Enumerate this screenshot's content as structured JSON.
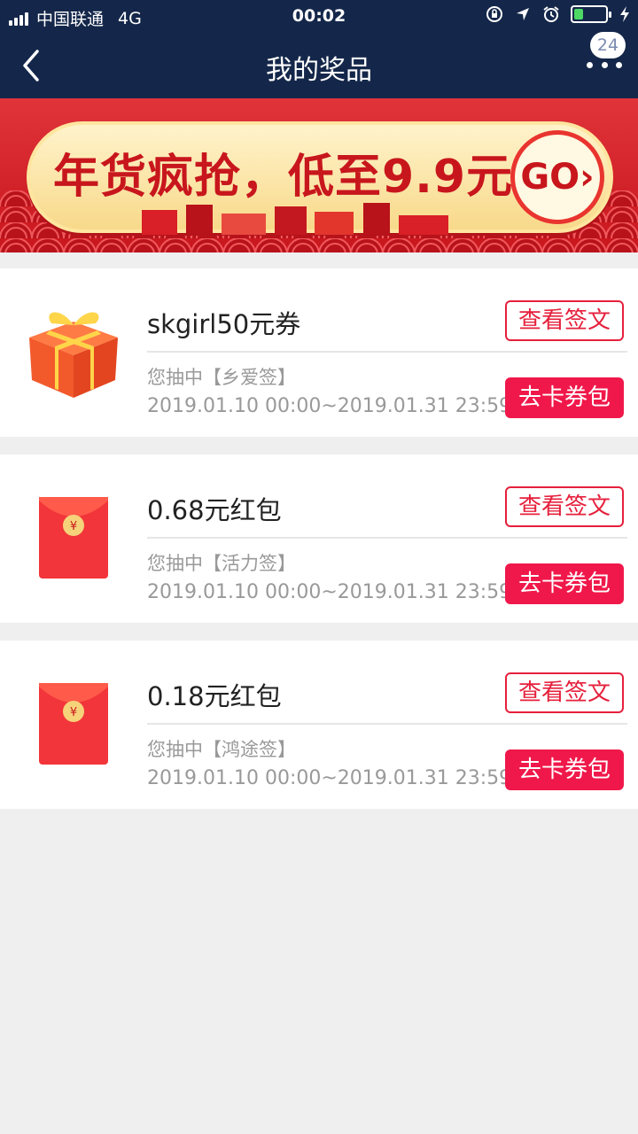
{
  "status_bar": {
    "carrier": "中国联通",
    "network": "4G",
    "time": "00:02"
  },
  "nav": {
    "title": "我的奖品",
    "badge_count": "24"
  },
  "banner": {
    "text": "年货疯抢，低至9.9元",
    "go_label": "GO›"
  },
  "colors": {
    "header_bg": "#14274a",
    "accent": "#f0184a",
    "page_bg": "#efefef"
  },
  "prizes": [
    {
      "icon": "gift-box-icon",
      "title": "skgirl50元券",
      "from": "您抽中【乡爱签】",
      "date": "2019.01.10 00:00~2019.01.31 23:59",
      "view_label": "查看签文",
      "go_label": "去卡券包"
    },
    {
      "icon": "red-envelope-icon",
      "title": "0.68元红包",
      "from": "您抽中【活力签】",
      "date": "2019.01.10 00:00~2019.01.31 23:59",
      "view_label": "查看签文",
      "go_label": "去卡券包"
    },
    {
      "icon": "red-envelope-icon",
      "title": "0.18元红包",
      "from": "您抽中【鸿途签】",
      "date": "2019.01.10 00:00~2019.01.31 23:59",
      "view_label": "查看签文",
      "go_label": "去卡券包"
    }
  ]
}
